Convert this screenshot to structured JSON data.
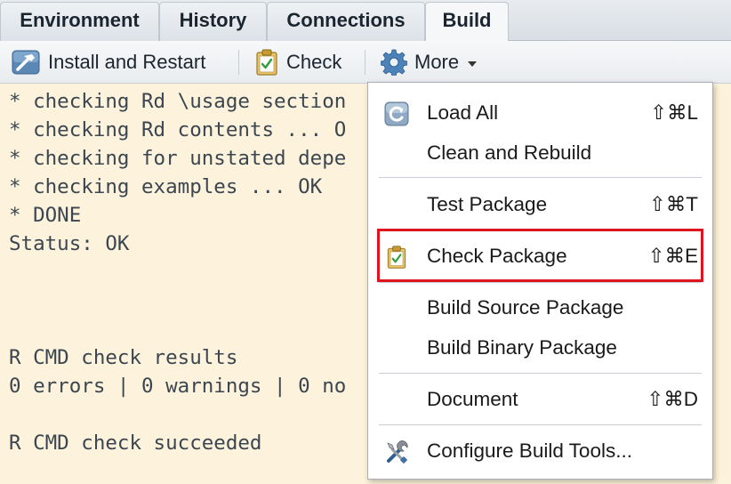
{
  "tabs": [
    {
      "label": "Environment"
    },
    {
      "label": "History"
    },
    {
      "label": "Connections"
    },
    {
      "label": "Build"
    }
  ],
  "toolbar": {
    "install_label": "Install and Restart",
    "check_label": "Check",
    "more_label": "More"
  },
  "console": {
    "lines": [
      "* checking Rd \\usage section",
      "* checking Rd contents ... O",
      "* checking for unstated depe",
      "* checking examples ... OK",
      "* DONE",
      "Status: OK",
      "R CMD check results",
      "0 errors | 0 warnings | 0 no",
      "R CMD check succeeded"
    ]
  },
  "menu": {
    "items": [
      {
        "label": "Load All",
        "shortcut": "⇧⌘L",
        "icon": "load-all-icon"
      },
      {
        "label": "Clean and Rebuild",
        "shortcut": ""
      },
      {
        "label": "Test Package",
        "shortcut": "⇧⌘T"
      },
      {
        "label": "Check Package",
        "shortcut": "⇧⌘E",
        "icon": "clipboard-check-icon"
      },
      {
        "label": "Build Source Package",
        "shortcut": ""
      },
      {
        "label": "Build Binary Package",
        "shortcut": ""
      },
      {
        "label": "Document",
        "shortcut": "⇧⌘D"
      },
      {
        "label": "Configure Build Tools...",
        "shortcut": "",
        "icon": "tools-icon"
      }
    ]
  },
  "colors": {
    "console_bg": "#fdf3dc",
    "highlight_border": "#e0141e",
    "console_text": "#3b4650"
  }
}
